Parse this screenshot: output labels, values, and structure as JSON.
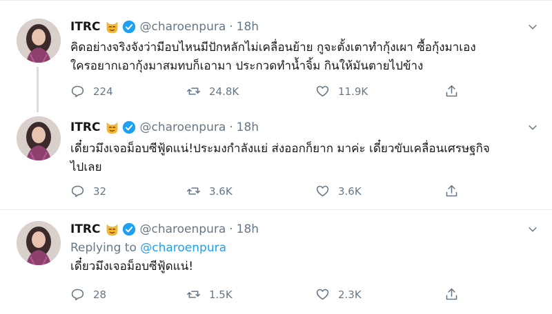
{
  "tweets": [
    {
      "name": "ITRC",
      "handle": "@charoenpura",
      "dot": "·",
      "time": "18h",
      "reply_prefix": "",
      "reply_mention": "",
      "text_lines": [
        "คิดอย่างจริงจังว่ามีอบไหนมีปักหลักไม่เคลื่อนย้าย กูจะตั้งเตาทำกุ้งเผา ซื้อกุ้งมาเอง",
        "ใครอยากเอากุ้งมาสมทบก็เอามา ประกวดทำน้ำจิ้ม กินให้มันตายไปข้าง"
      ],
      "replies": "224",
      "retweets": "24.8K",
      "likes": "11.9K"
    },
    {
      "name": "ITRC",
      "handle": "@charoenpura",
      "dot": "·",
      "time": "18h",
      "reply_prefix": "",
      "reply_mention": "",
      "text_lines": [
        "เดี๋ยวมึงเจอม็อบซีฟู้ดแน่!ประมงกำลังแย่ ส่งออกก็ยาก มาค่ะ เดี๋ยวขับเคลื่อนเศรษฐกิจ",
        "ไปเลย"
      ],
      "replies": "32",
      "retweets": "3.6K",
      "likes": "3.6K"
    },
    {
      "name": "ITRC",
      "handle": "@charoenpura",
      "dot": "·",
      "time": "18h",
      "reply_prefix": "Replying to",
      "reply_mention": "@charoenpura",
      "text_lines": [
        "เดี๋ยวมึงเจอม็อบซีฟู้ดแน่!"
      ],
      "replies": "28",
      "retweets": "1.5K",
      "likes": "2.3K"
    }
  ],
  "icons": {
    "reply": "reply-icon",
    "retweet": "retweet-icon",
    "like": "like-icon",
    "share": "share-icon",
    "more": "chevron-down-icon",
    "verified": "verified-badge-icon",
    "name_emoji": "smiling-cat-emoji-icon"
  },
  "colors": {
    "text": "#14171a",
    "muted": "#657786",
    "accent": "#1da1f2",
    "divider": "#e6ecf0",
    "thread_line": "#d6dde3"
  }
}
